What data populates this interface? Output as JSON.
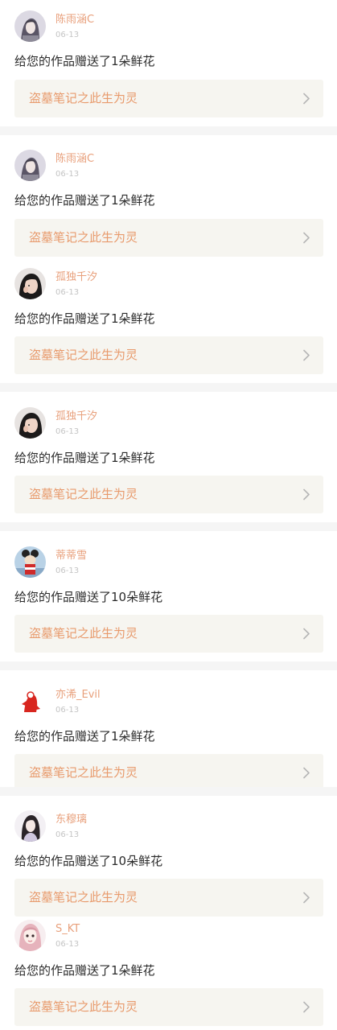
{
  "notifications": [
    {
      "username": "陈雨涵C",
      "date": "06-13",
      "message": "给您的作品赠送了1朵鲜花",
      "work_title": "盗墓笔记之此生为灵",
      "avatar": "girl-hair-avatar",
      "chevron": "chevron-right-icon"
    },
    {
      "username": "陈雨涵C",
      "date": "06-13",
      "message": "给您的作品赠送了1朵鲜花",
      "work_title": "盗墓笔记之此生为灵",
      "avatar": "girl-hair-avatar",
      "chevron": "chevron-right-icon"
    },
    {
      "username": "孤独千汐",
      "date": "06-13",
      "message": "给您的作品赠送了1朵鲜花",
      "work_title": "盗墓笔记之此生为灵",
      "avatar": "girl-face-avatar",
      "chevron": "chevron-right-icon"
    },
    {
      "username": "孤独千汐",
      "date": "06-13",
      "message": "给您的作品赠送了1朵鲜花",
      "work_title": "盗墓笔记之此生为灵",
      "avatar": "girl-face-avatar",
      "chevron": "chevron-right-icon"
    },
    {
      "username": "蒂蒂雪",
      "date": "06-13",
      "message": "给您的作品赠送了10朵鲜花",
      "work_title": "盗墓笔记之此生为灵",
      "avatar": "mouse-figure-avatar",
      "chevron": "chevron-right-icon"
    },
    {
      "username": "亦浠_Evil",
      "date": "06-13",
      "message": "给您的作品赠送了1朵鲜花",
      "work_title": "盗墓笔记之此生为灵",
      "avatar": "red-figure-avatar",
      "chevron": "chevron-right-icon"
    },
    {
      "username": "东穆璃",
      "date": "06-13",
      "message": "给您的作品赠送了10朵鲜花",
      "work_title": "盗墓笔记之此生为灵",
      "avatar": "dark-hair-girl-avatar",
      "chevron": "chevron-right-icon"
    },
    {
      "username": "S_KT",
      "date": "06-13",
      "message": "给您的作品赠送了1朵鲜花",
      "work_title": "盗墓笔记之此生为灵",
      "avatar": "pink-hair-girl-avatar",
      "chevron": "chevron-right-icon"
    }
  ],
  "colors": {
    "username": "#e8a07c",
    "work_title": "#e89a6c",
    "card_bg": "#f6f5f0",
    "divider": "#f5f5f5"
  }
}
